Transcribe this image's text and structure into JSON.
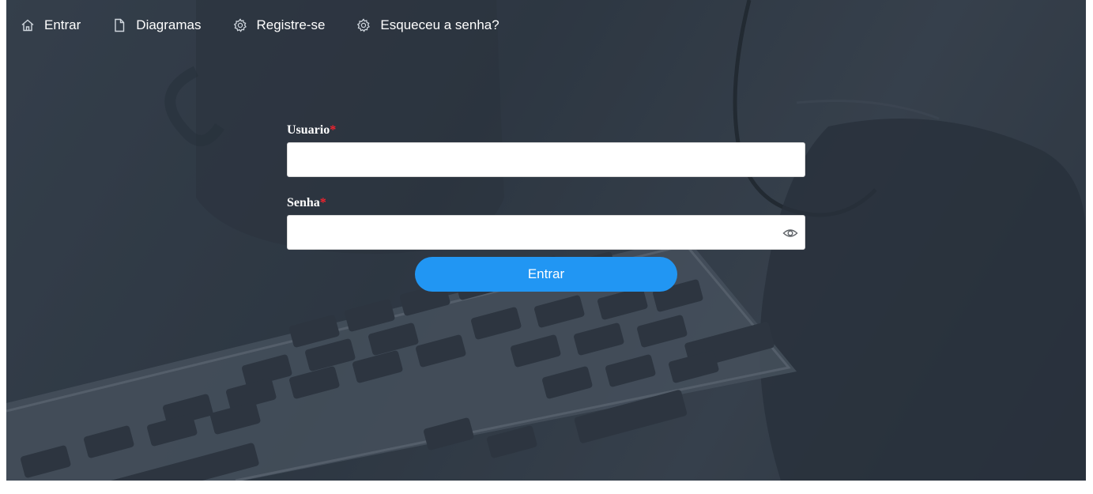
{
  "nav": {
    "items": [
      {
        "label": "Entrar",
        "icon": "home-icon"
      },
      {
        "label": "Diagramas",
        "icon": "file-icon"
      },
      {
        "label": "Registre-se",
        "icon": "gear-icon"
      },
      {
        "label": "Esqueceu a senha?",
        "icon": "gear-icon"
      }
    ]
  },
  "form": {
    "username": {
      "label": "Usuario",
      "required_mark": "*",
      "value": ""
    },
    "password": {
      "label": "Senha",
      "required_mark": "*",
      "value": "",
      "toggle_icon": "eye-icon"
    },
    "submit_label": "Entrar"
  },
  "colors": {
    "accent": "#2196f3",
    "required": "#f5222d",
    "overlay": "#34404c"
  }
}
